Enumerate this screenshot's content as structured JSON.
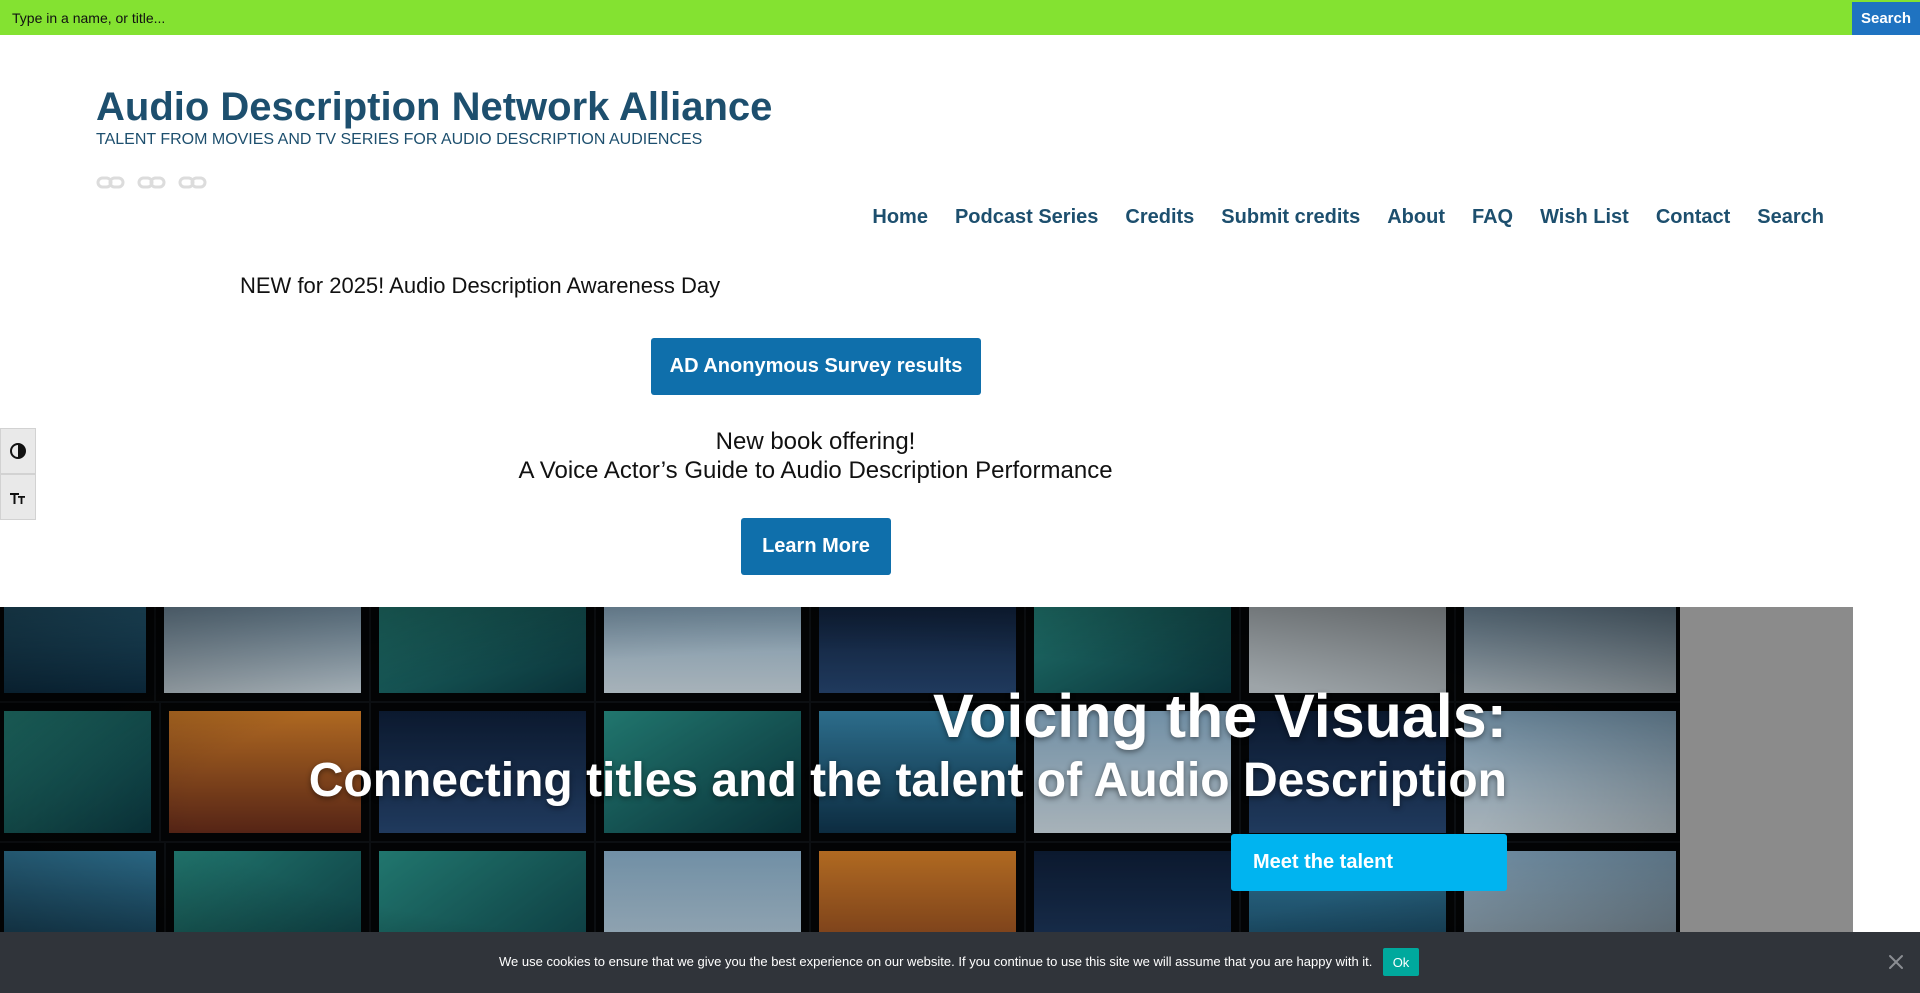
{
  "search_bar": {
    "placeholder": "Type in a name, or title...",
    "button_label": "Search"
  },
  "site": {
    "title": "Audio Description Network Alliance",
    "tagline": "TALENT FROM MOVIES AND TV SERIES FOR AUDIO DESCRIPTION AUDIENCES",
    "social_icons": [
      "link-icon",
      "link-icon",
      "link-icon"
    ]
  },
  "nav": {
    "items": [
      {
        "label": "Home"
      },
      {
        "label": "Podcast Series"
      },
      {
        "label": "Credits"
      },
      {
        "label": "Submit credits"
      },
      {
        "label": "About"
      },
      {
        "label": "FAQ"
      },
      {
        "label": "Wish List"
      },
      {
        "label": "Contact"
      },
      {
        "label": "Search"
      }
    ]
  },
  "accessibility_toolbar": {
    "items": [
      "contrast-icon",
      "font-size-icon"
    ]
  },
  "main": {
    "notice": "NEW for 2025! Audio Description Awareness Day",
    "survey_button": "AD Anonymous Survey results",
    "book_line1": "New book offering!",
    "book_line2": "A Voice Actor’s Guide to Audio Description Performance",
    "learn_more_button": "Learn More"
  },
  "hero": {
    "title": "Voicing the Visuals:",
    "subtitle": "Connecting titles and the talent of Audio Description",
    "cta": "Meet the talent"
  },
  "cookie_banner": {
    "text": "We use cookies to ensure that we give you the best experience on our website. If you continue to use this site we will assume that you are happy with it.",
    "ok_label": "Ok"
  },
  "colors": {
    "top_bar": "#84e231",
    "search_button": "#1f73c1",
    "heading": "#1d4f6e",
    "primary_button": "#0f6fab",
    "hero_cta": "#00b4f0",
    "cookie_bg": "#30343a",
    "cookie_ok": "#00a99d"
  }
}
